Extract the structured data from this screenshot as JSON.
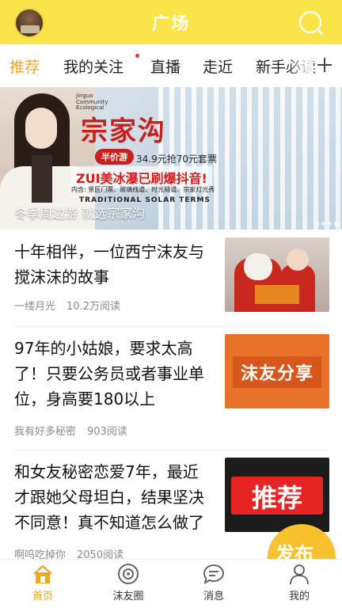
{
  "header": {
    "title": "广场",
    "avatar_icon": "avatar",
    "search_icon": "search-icon"
  },
  "tabs": [
    {
      "label": "推荐",
      "active": true
    },
    {
      "label": "我的关注",
      "badge": true
    },
    {
      "label": "直播"
    },
    {
      "label": "走近"
    },
    {
      "label": "新手必读"
    }
  ],
  "tabs_add_icon": "plus-icon",
  "banner": {
    "brand": "宗家沟",
    "vertical_text": "Jinguo Community Ecological",
    "badge": "半价游",
    "price": "34.9元抢70元套票",
    "headline": "ZUI美冰瀑已刷爆抖音!",
    "includes": "内含: 景区门票、玻璃栈道、时光隧道、宗家灯光秀",
    "english": "TRADITIONAL SOLAR TERMS",
    "caption": "冬季周边游 就选宗家沟",
    "slide_count": 4,
    "active_slide": 4
  },
  "articles": [
    {
      "title": "十年相伴，一位西宁沫友与搅沫沫的故事",
      "author": "一缕月光",
      "reads": "10.2万阅读",
      "thumbnail": "santa-photo"
    },
    {
      "title": "97年的小姑娘，要求太高了！只要公务员或者事业单位，身高要180以上",
      "author": "我有好多秘密",
      "reads": "903阅读",
      "thumbnail_text": "沫友分享"
    },
    {
      "title": "和女友秘密恋爱7年，最近才跟她父母坦白，结果坚决不同意！真不知道怎么做了",
      "author": "啊呜吃掉你",
      "reads": "2050阅读",
      "thumbnail_text": "推荐"
    }
  ],
  "publish_button": "发布",
  "bottom_nav": [
    {
      "label": "首页",
      "icon": "home-icon",
      "active": true
    },
    {
      "label": "沫友圈",
      "icon": "circle-icon"
    },
    {
      "label": "消息",
      "icon": "message-icon"
    },
    {
      "label": "我的",
      "icon": "profile-icon"
    }
  ],
  "colors": {
    "header_bg": "#fbe44a",
    "accent": "#f2a51f",
    "publish": "#f5c12c"
  }
}
